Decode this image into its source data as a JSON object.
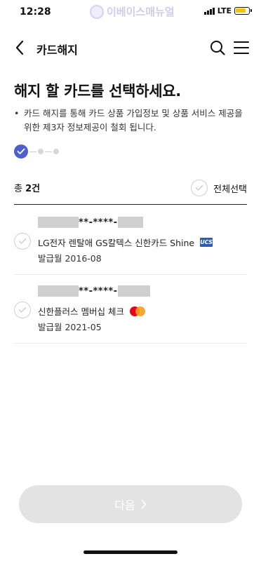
{
  "status_bar": {
    "time": "12:28",
    "network": "LTE",
    "watermark": "이베이스매뉴얼"
  },
  "header": {
    "title": "카드해지",
    "back_icon": "chevron-left-icon",
    "search_icon": "search-icon",
    "menu_icon": "hamburger-menu-icon"
  },
  "page": {
    "title": "해지 할 카드를 선택하세요.",
    "notice_bullet": "•",
    "notice": "카드 해지를 통해 카드 상품 가입정보 및 상품 서비스 제공을 위한 제3자 정보제공이 철회 됩니다."
  },
  "stepper": {
    "current_step": 1,
    "total_steps": 3
  },
  "summary": {
    "total_prefix": "총 ",
    "total_count": "2건",
    "select_all_label": "전체선택"
  },
  "cards": [
    {
      "number_mask": "**-****-",
      "name": "LG전자 렌탈애 GS칼텍스 신한카드 Shine",
      "brand": "UCS",
      "brand_icon": "ucs-brand-icon",
      "issue_date": "발급월 2016-08"
    },
    {
      "number_mask": "**-****-",
      "name": "신한플러스 멤버십 체크",
      "brand": "Mastercard",
      "brand_icon": "mastercard-icon",
      "issue_date": "발급월 2021-05"
    }
  ],
  "footer": {
    "next_label": "다음",
    "next_enabled": false
  },
  "colors": {
    "accent": "#4e5fcf",
    "disabled_button": "#e3e3e3",
    "check_border": "#cfcfcf",
    "mastercard_red": "#eb001b",
    "mastercard_yellow": "#f79e1b",
    "ucs_blue": "#2b5fae"
  }
}
